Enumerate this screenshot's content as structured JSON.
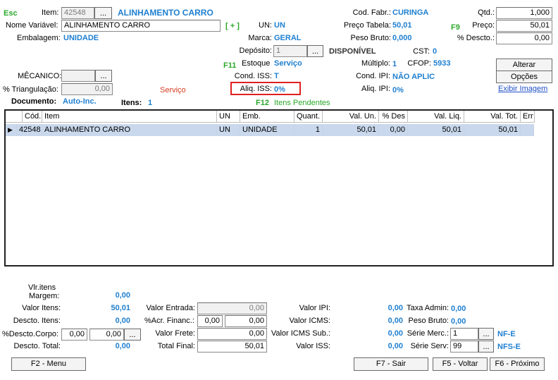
{
  "keys": {
    "esc": "Esc",
    "f9": "F9",
    "f11": "F11",
    "f12": "F12"
  },
  "header": {
    "item_label": "Item:",
    "item_code": "42548",
    "item_btn": "...",
    "item_name": "ALINHAMENTO CARRO",
    "cod_fabr_label": "Cod. Fabr.:",
    "cod_fabr_value": "CURINGA",
    "qtd_label": "Qtd.:",
    "qtd_value": "1,000",
    "nome_var_label": "Nome Variável:",
    "nome_var_value": "ALINHAMENTO CARRO",
    "plus": "[ + ]",
    "un_label": "UN:",
    "un_value": "UN",
    "preco_tabela_label": "Preço Tabela:",
    "preco_tabela_value": "50,01",
    "preco_label": "Preço:",
    "preco_value": "50,01",
    "embalagem_label": "Embalagem:",
    "embalagem_value": "UNIDADE",
    "marca_label": "Marca:",
    "marca_value": "GERAL",
    "peso_bruto_label": "Peso Bruto:",
    "peso_bruto_value": "0,000",
    "descto_label": "% Descto.:",
    "descto_value": "0,00",
    "deposito_label": "Depósito:",
    "deposito_value": "1",
    "deposito_btn": "...",
    "disponivel": "DISPONÍVEL",
    "cst_label": "CST:",
    "cst_value": "0",
    "estoque_label": "Estoque",
    "estoque_value": "Serviço",
    "multiplo_label": "Múltiplo:",
    "multiplo_value": "1",
    "cfop_label": "CFOP:",
    "cfop_value": "5933",
    "mecanico_label": "MÊCANICO:",
    "mecanico_btn": "...",
    "cond_iss_label": "Cond. ISS:",
    "cond_iss_value": "T",
    "cond_ipi_label": "Cond. IPI:",
    "cond_ipi_value": "NÃO APLIC",
    "triang_label": "% Triangulação:",
    "triang_value": "0,00",
    "servico": "Serviço",
    "aliq_iss_label": "Aliq. ISS:",
    "aliq_iss_value": "0%",
    "aliq_ipi_label": "Aliq. IPI:",
    "aliq_ipi_value": "0%",
    "alterar_btn": "Alterar",
    "opcoes_btn": "Opções",
    "exibir_imagem": "Exibir Imagem",
    "documento_label": "Documento:",
    "documento_value": "Auto-Inc.",
    "itens_label": "Itens:",
    "itens_value": "1",
    "itens_pendentes": "Itens Pendentes"
  },
  "grid": {
    "columns": [
      "Cód.",
      "Item",
      "UN",
      "Emb.",
      "Quant.",
      "Val. Un.",
      "% Des",
      "Val. Liq.",
      "Val. Tot.",
      "Err"
    ],
    "rows": [
      {
        "cod": "42548",
        "item": "ALINHAMENTO CARRO",
        "un": "UN",
        "emb": "UNIDADE",
        "quant": "1",
        "val_un": "50,01",
        "des": "0,00",
        "val_liq": "50,01",
        "val_tot": "50,01",
        "err": ""
      }
    ]
  },
  "totals": {
    "vlr_itens_label": "Vlr.itens",
    "margem_label": "Margem:",
    "margem_value": "0,00",
    "valor_itens_label": "Valor Itens:",
    "valor_itens_value": "50,01",
    "descto_itens_label": "Descto. Itens:",
    "descto_itens_value": "0,00",
    "descto_corpo_label": "%Descto.Corpo:",
    "descto_corpo_pct": "0,00",
    "descto_corpo_val": "0,00",
    "descto_corpo_btn": "...",
    "descto_total_label": "Descto. Total:",
    "descto_total_value": "0,00",
    "valor_entrada_label": "Valor Entrada:",
    "valor_entrada_value": "0,00",
    "acr_financ_label": "%Acr. Financ.:",
    "acr_financ_pct": "0,00",
    "acr_financ_val": "0,00",
    "valor_frete_label": "Valor Frete:",
    "valor_frete_value": "0,00",
    "total_final_label": "Total Final:",
    "total_final_value": "50,01",
    "valor_ipi_label": "Valor IPI:",
    "valor_ipi_value": "0,00",
    "valor_icms_label": "Valor ICMS:",
    "valor_icms_value": "0,00",
    "valor_icms_sub_label": "Valor ICMS Sub.:",
    "valor_icms_sub_value": "0,00",
    "valor_iss_label": "Valor ISS:",
    "valor_iss_value": "0,00",
    "taxa_admin_label": "Taxa Admin:",
    "taxa_admin_value": "0,00",
    "peso_bruto_label": "Peso Bruto:",
    "peso_bruto_value": "0,00",
    "serie_merc_label": "Série Merc.:",
    "serie_merc_value": "1",
    "serie_merc_btn": "...",
    "nfe": "NF-E",
    "serie_serv_label": "Série Serv:",
    "serie_serv_value": "99",
    "serie_serv_btn": "...",
    "nfse": "NFS-E"
  },
  "footer": {
    "menu": "F2 - Menu",
    "sair": "F7 - Sair",
    "voltar": "F5 - Voltar",
    "proximo": "F6 - Próximo"
  }
}
